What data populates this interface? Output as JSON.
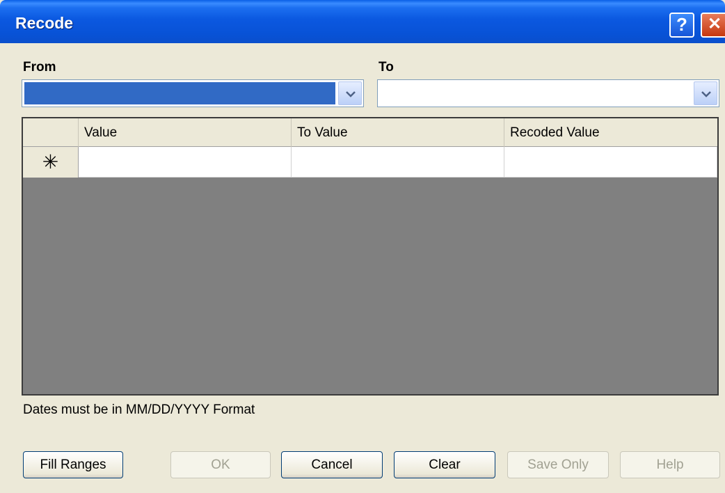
{
  "window": {
    "title": "Recode"
  },
  "titlebar": {
    "help_glyph": "?",
    "close_glyph": "✕"
  },
  "from": {
    "label": "From",
    "value": ""
  },
  "to": {
    "label": "To",
    "value": ""
  },
  "grid": {
    "columns": [
      "Value",
      "To Value",
      "Recoded Value"
    ],
    "new_row_marker": "✳",
    "rows": [
      {
        "value": "",
        "to_value": "",
        "recoded_value": ""
      }
    ]
  },
  "note": "Dates must be in MM/DD/YYYY Format",
  "buttons": {
    "fill_ranges": "Fill Ranges",
    "ok": "OK",
    "cancel": "Cancel",
    "clear": "Clear",
    "save_only": "Save Only",
    "help": "Help"
  },
  "colors": {
    "titlebar": "#0852d6",
    "selection": "#316ac5",
    "grid_empty": "#808080",
    "dialog_bg": "#ece9d8"
  }
}
